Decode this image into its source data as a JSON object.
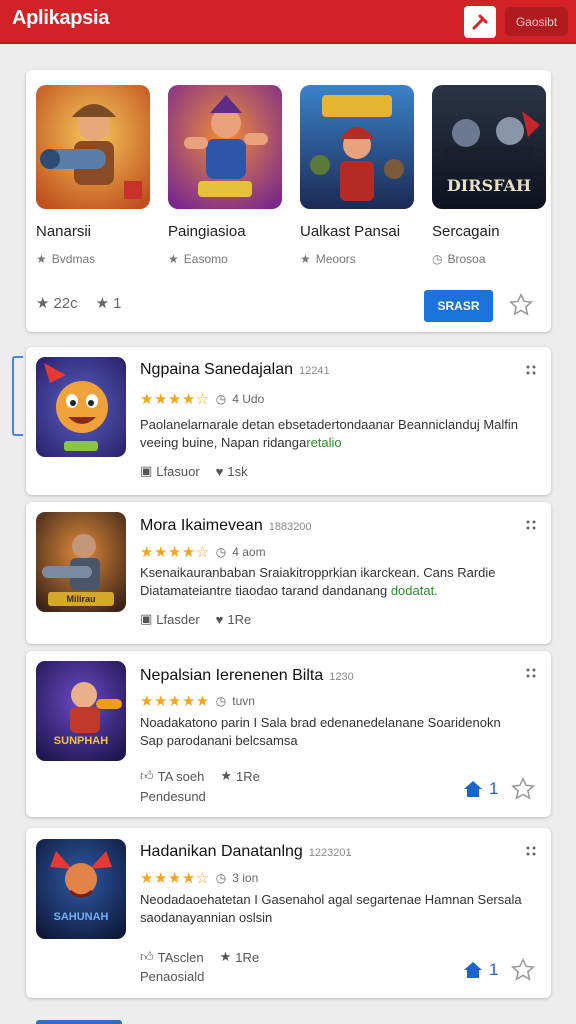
{
  "app": {
    "title": "Aplikapsia",
    "login_label": "Gaosibt"
  },
  "featured": {
    "items": [
      {
        "name": "Nanarsii",
        "meta": "Bvdmas"
      },
      {
        "name": "Paingiasioa",
        "meta": "Easomo"
      },
      {
        "name": "Ualkast Pansai",
        "meta": "Meoors"
      },
      {
        "name": "Sercagain",
        "meta": "Brosoa"
      }
    ],
    "stats_left": "22c",
    "stats_right": "1",
    "button_label": "SRASR",
    "dark_poster_text": "DIRSFAH"
  },
  "apps": [
    {
      "title": "Ngpaina Sanedajalan",
      "code": "12241",
      "age": "4 Udo",
      "desc": "Paolanelarnarale detan ebsetadertondaanar Beanniclanduj Malfin",
      "desc2": "veeing buine, Napan ridanga",
      "desc2_green": "retalio",
      "meta1": "Lfasuor",
      "meta2": "1sk",
      "banner": ""
    },
    {
      "title": "Mora Ikaimevean",
      "code": "1883200",
      "age": "4 aom",
      "desc": "Ksenaikauranbaban Sraiakitropprkian ikarckean. Cans Rardie",
      "desc2": "Diatamateiantre tiaodao tarand dandanang",
      "desc2_green": "dodatat.",
      "meta1": "Lfasder",
      "meta2": "1Re",
      "banner": "Milirau"
    },
    {
      "title": "Nepalsian Ierenenen Bilta",
      "code": "1230",
      "age": "tuvn",
      "desc": "Noadakatono parin I Sala brad edenanedelanane Soaridenokn",
      "desc2": "Sap parodanani belcsamsa",
      "desc2_green": "",
      "meta1": "TA soeh",
      "meta2": "1Re",
      "sub": "Pendesund",
      "home_count": "1",
      "banner": "SUNPHAH"
    },
    {
      "title": "Hadanikan Danatanlng",
      "code": "1223201",
      "age": "3 ion",
      "desc": "Neodadaoehatetan I Gasenahol agal segartenae Hamnan Sersala",
      "desc2": "saodanayannian oslsin",
      "desc2_green": "",
      "meta1": "TAsclen",
      "meta2": "1Re",
      "sub": "Penaosiald",
      "home_count": "1",
      "banner": "SAHUNAH"
    }
  ],
  "colors": {
    "brand": "#d32226",
    "accent": "#1a73d9",
    "star": "#f4a623"
  }
}
